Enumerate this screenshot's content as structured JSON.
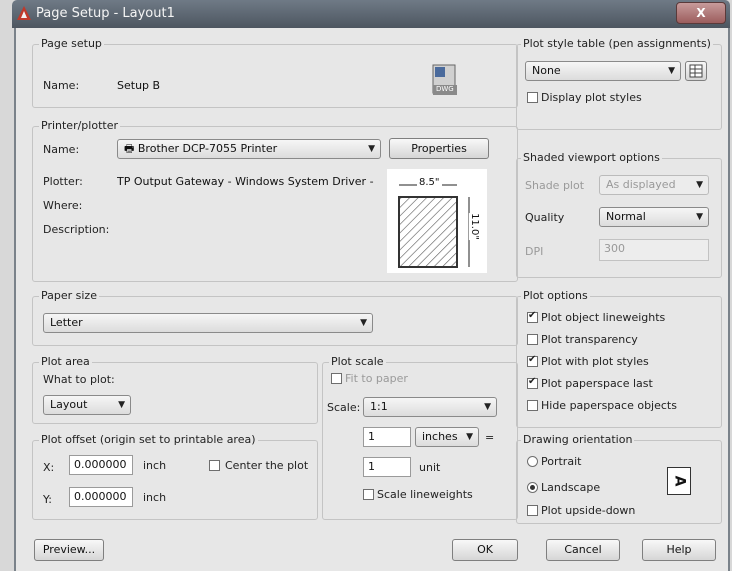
{
  "window": {
    "title": "Page Setup - Layout1",
    "close_glyph": "X"
  },
  "page_setup": {
    "group_label": "Page setup",
    "name_label": "Name:",
    "name_value": "Setup B",
    "dwg_icon_text": "DWG"
  },
  "printer": {
    "group_label": "Printer/plotter",
    "name_label": "Name:",
    "name_value": "Brother DCP-7055 Printer",
    "properties_label": "Properties",
    "plotter_label": "Plotter:",
    "plotter_value": "TP Output Gateway - Windows System Driver - by ...",
    "where_label": "Where:",
    "description_label": "Description:",
    "preview_width": "8.5\"",
    "preview_height": "11.0\""
  },
  "paper_size": {
    "group_label": "Paper size",
    "value": "Letter"
  },
  "plot_area": {
    "group_label": "Plot area",
    "what_label": "What to plot:",
    "what_value": "Layout"
  },
  "plot_offset": {
    "group_label": "Plot offset (origin set to printable area)",
    "x_label": "X:",
    "x_value": "0.000000",
    "x_unit": "inch",
    "y_label": "Y:",
    "y_value": "0.000000",
    "y_unit": "inch",
    "center_label": "Center the plot"
  },
  "plot_scale": {
    "group_label": "Plot scale",
    "fit_label": "Fit to paper",
    "scale_label": "Scale:",
    "scale_value": "1:1",
    "value1": "1",
    "unit1": "inches",
    "equals": "=",
    "value2": "1",
    "unit2": "unit",
    "lineweights_label": "Scale lineweights"
  },
  "plot_style_table": {
    "group_label": "Plot style table (pen assignments)",
    "value": "None",
    "display_label": "Display plot styles"
  },
  "shaded_viewport": {
    "group_label": "Shaded viewport options",
    "shade_label": "Shade plot",
    "shade_value": "As displayed",
    "quality_label": "Quality",
    "quality_value": "Normal",
    "dpi_label": "DPI",
    "dpi_value": "300"
  },
  "plot_options": {
    "group_label": "Plot options",
    "items": [
      {
        "label": "Plot object lineweights",
        "checked": true
      },
      {
        "label": "Plot transparency",
        "checked": false
      },
      {
        "label": "Plot with plot styles",
        "checked": true
      },
      {
        "label": "Plot paperspace last",
        "checked": true
      },
      {
        "label": "Hide paperspace objects",
        "checked": false
      }
    ]
  },
  "orientation": {
    "group_label": "Drawing orientation",
    "portrait_label": "Portrait",
    "landscape_label": "Landscape",
    "upside_label": "Plot upside-down",
    "selected": "Landscape",
    "icon_letter": "A"
  },
  "buttons": {
    "preview": "Preview...",
    "ok": "OK",
    "cancel": "Cancel",
    "help": "Help"
  }
}
